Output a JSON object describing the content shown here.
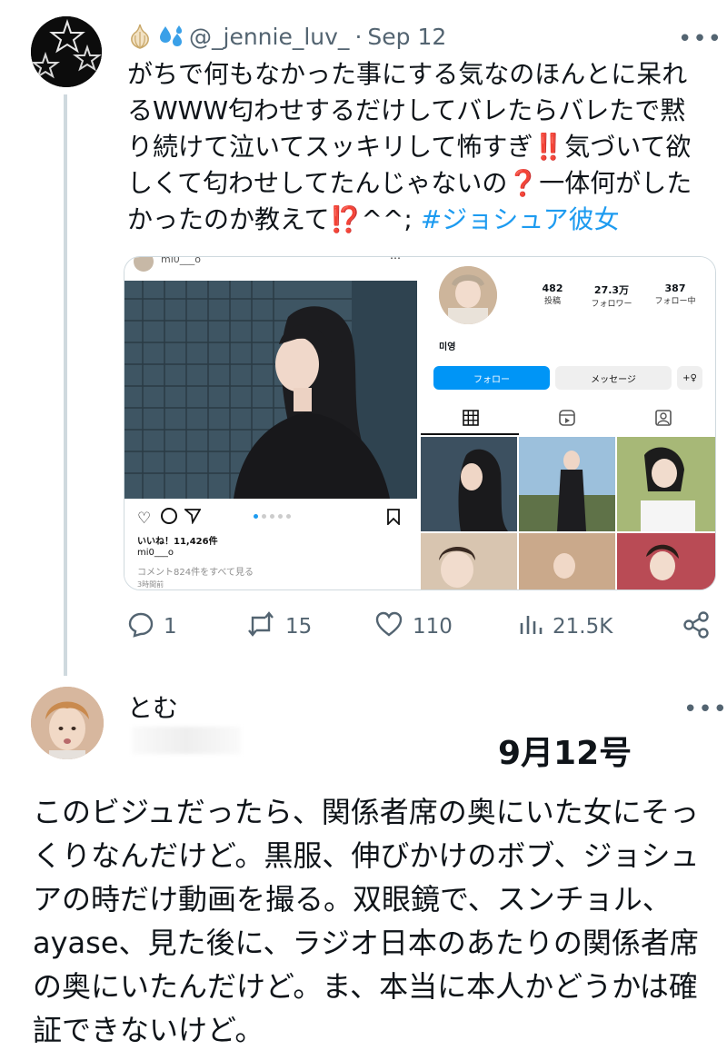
{
  "tweet1": {
    "handle": "@_jennie_luv_",
    "separator": "·",
    "date": "Sep 12",
    "more": "•••",
    "text_part1": "がちで何もなかった事にする気なのほんとに呆れるWWW匂わせするだけしてバレたらバレたで黙り続けて泣いてスッキリして怖すぎ",
    "emoji1": "‼️",
    "text_part2": "気づいて欲しくて匂わせしてたんじゃないの",
    "emoji2": "❓",
    "text_part3": "一体何がしたかったのか教えて",
    "emoji3": "⁉️",
    "text_part4": "^^;",
    "hashtag": "#ジョシュア彼女",
    "actions": {
      "reply_count": "1",
      "retweet_count": "15",
      "like_count": "110",
      "view_count": "21.5K"
    }
  },
  "embedded_instagram": {
    "post_username": "mi0___o",
    "likes": "いいね！11,426件",
    "caption_user": "mi0___o",
    "comments_link": "コメント824件をすべて見る",
    "posted_time": "3時間前",
    "profile": {
      "posts_count": "482",
      "posts_label": "投稿",
      "followers_count": "27.3万",
      "followers_label": "フォロワー",
      "following_count": "387",
      "following_label": "フォロー中",
      "display_name": "미영",
      "follow_button": "フォロー",
      "message_button": "メッセージ",
      "add_user_button": "+♀"
    }
  },
  "tweet2": {
    "name": "とむ",
    "more": "•••",
    "date_overlay": "9月12号",
    "text": "このビジュだったら、関係者席の奥にいた女にそっくりなんだけど。黒服、伸びかけのボブ、ジョシュアの時だけ動画を撮る。双眼鏡で、スンチョル、ayase、見た後に、ラジオ日本のあたりの関係者席の奥にいたんだけど。ま、本当に本人かどうかは確証できないけど。"
  },
  "colors": {
    "text": "#0f1419",
    "muted": "#536471",
    "accent": "#1d9bf0",
    "alert_red": "#e0245e",
    "instagram_blue": "#0095f6"
  }
}
